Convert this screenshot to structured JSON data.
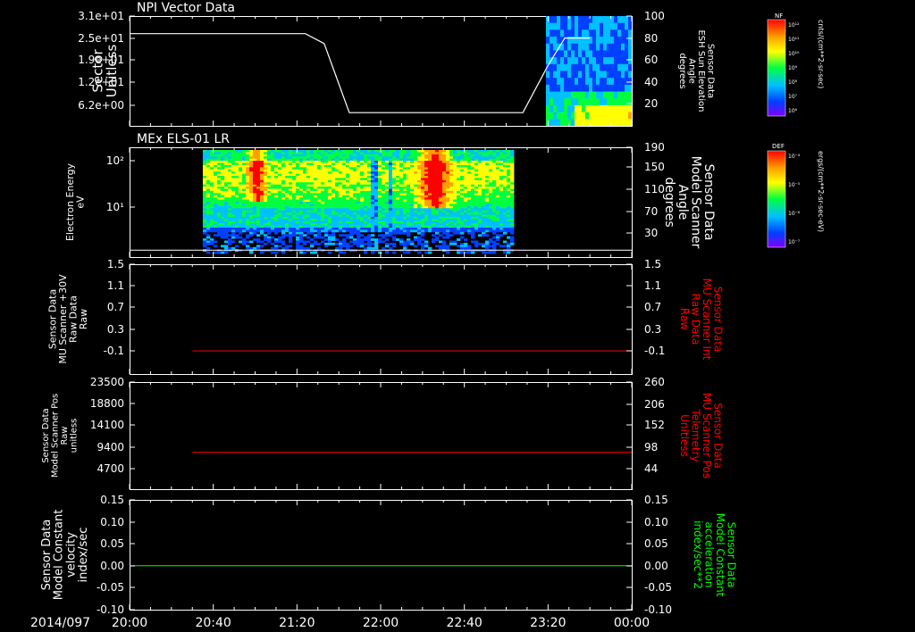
{
  "date_label": "2014/097",
  "time_ticks": [
    "20:00",
    "20:40",
    "21:20",
    "22:00",
    "22:40",
    "23:20",
    "00:00"
  ],
  "chart_data": [
    {
      "type": "heatmap",
      "title": "NPI Vector Data",
      "ylabel_lines": [
        "Sector",
        "Unitless"
      ],
      "yticks": [
        "3.1e+01",
        "2.5e+01",
        "1.9e+01",
        "1.2e+01",
        "6.2e+00"
      ],
      "right_ylabel_lines": [
        "Sensor Data",
        "ESH Sun Elevation",
        "Angle",
        "degrees"
      ],
      "right_yticks": [
        "100",
        "80",
        "60",
        "40",
        "20"
      ],
      "right_ylim": [
        0,
        100
      ],
      "line_series": {
        "x": [
          "20:00",
          "21:24",
          "21:33",
          "21:45",
          "23:08",
          "23:20",
          "23:28",
          "23:40"
        ],
        "y": [
          84,
          84,
          75,
          12,
          12,
          55,
          80,
          80
        ]
      },
      "spectrogram_extent": [
        "23:19",
        "00:00"
      ],
      "colorbar": {
        "label": "NF",
        "units": "cnts/(cm**2-sr-sec)",
        "tick_labels": [
          "10¹²",
          "10¹¹",
          "10¹⁰",
          "10⁹",
          "10⁸",
          "10⁷",
          "10⁶"
        ],
        "colors": [
          "#ff0000",
          "#ffa000",
          "#ffff00",
          "#00ff40",
          "#00c0ff",
          "#0040ff",
          "#8000ff"
        ]
      }
    },
    {
      "type": "heatmap",
      "title": "MEx ELS-01 LR",
      "ylabel_lines": [
        "Electron Energy",
        "eV"
      ],
      "yticks": [
        "10²",
        "10¹"
      ],
      "ylim": [
        1,
        200
      ],
      "log_scale": true,
      "right_ylabel_lines": [
        "Sensor Data",
        "Model Scanner",
        "Angle",
        "degrees"
      ],
      "right_yticks": [
        "190",
        "150",
        "110",
        "70",
        "30"
      ],
      "right_ylim": [
        10,
        190
      ],
      "line_series": {
        "x": [
          "20:00",
          "00:00"
        ],
        "y": [
          12,
          12
        ]
      },
      "spectrogram_extent": [
        "20:35",
        "23:02"
      ],
      "colorbar": {
        "label": "DEF",
        "units": "ergs/(cm**2-sr-sec-eV)",
        "tick_labels": [
          "10⁻⁴",
          "10⁻⁵",
          "10⁻⁶",
          "10⁻⁷"
        ],
        "colors": [
          "#ff0000",
          "#ffa000",
          "#ffff00",
          "#00ff40",
          "#00c0ff",
          "#0040ff",
          "#8000ff"
        ]
      }
    },
    {
      "type": "line",
      "ylabel_lines": [
        "Sensor Data",
        "MU Scanner +30V",
        "Raw Data",
        "Raw"
      ],
      "yticks": [
        "1.5",
        "1.1",
        "0.7",
        "0.3",
        "-0.1"
      ],
      "ylim": [
        -0.4,
        1.5
      ],
      "right_ylabel_lines": [
        "Sensor Data",
        "MU Scanner Int",
        "Raw Data",
        "Raw"
      ],
      "right_yticks": [
        "1.5",
        "1.1",
        "0.7",
        "0.3",
        "-0.1"
      ],
      "series": [
        {
          "color": "#ff0000",
          "x": [
            "20:30",
            "00:00"
          ],
          "y": [
            0.0,
            0.0
          ]
        }
      ]
    },
    {
      "type": "line",
      "ylabel_lines": [
        "Sensor Data",
        "Model Scanner Pos",
        "Raw",
        "unitless"
      ],
      "yticks": [
        "23500",
        "18800",
        "14100",
        "9400",
        "4700"
      ],
      "ylim": [
        0,
        23500
      ],
      "right_ylabel_lines": [
        "Sensor Data",
        "MU Scanner Pos",
        "Telemetry",
        "Unitless"
      ],
      "right_yticks": [
        "260",
        "206",
        "152",
        "98",
        "44"
      ],
      "series": [
        {
          "color": "#ff0000",
          "x": [
            "20:30",
            "00:00"
          ],
          "y": [
            8100,
            8100
          ]
        }
      ]
    },
    {
      "type": "line",
      "ylabel_lines": [
        "Sensor Data",
        "Model Constant",
        "velocity",
        "index/sec"
      ],
      "yticks": [
        "0.15",
        "0.10",
        "0.05",
        "0.00",
        "-0.05",
        "-0.10"
      ],
      "ylim": [
        -0.1,
        0.15
      ],
      "right_ylabel_lines": [
        "Sensor Data",
        "Model Constant",
        "acceleration",
        "index/sec**2"
      ],
      "right_yticks": [
        "0.15",
        "0.10",
        "0.05",
        "0.00",
        "-0.05",
        "-0.10"
      ],
      "series": [
        {
          "color": "#00ff00",
          "x": [
            "20:00",
            "00:00"
          ],
          "y": [
            0.0,
            0.0
          ]
        }
      ]
    }
  ]
}
